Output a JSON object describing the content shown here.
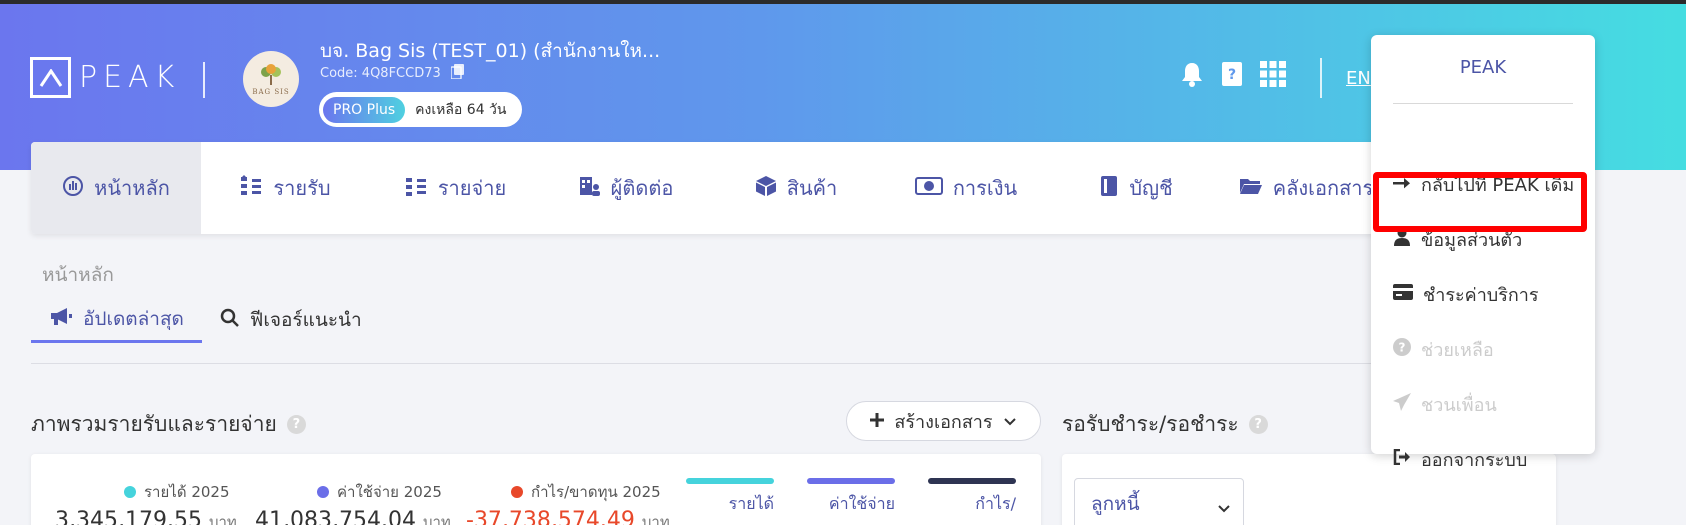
{
  "header": {
    "logo": "PEAK",
    "company_name": "บจ. Bag Sis (TEST_01) (สำนักงานให...",
    "company_code": "Code: 4Q8FCCD73",
    "avatar_text": "BAG SIS",
    "plan": "PRO Plus",
    "days_left": "คงเหลือ 64 วัน",
    "lang": "EN",
    "icons": [
      "bell-icon",
      "book-icon",
      "apps-grid-icon"
    ]
  },
  "nav": {
    "items": [
      {
        "label": "หน้าหลัก",
        "icon": "dashboard-icon"
      },
      {
        "label": "รายรับ",
        "icon": "income-icon"
      },
      {
        "label": "รายจ่าย",
        "icon": "expense-icon"
      },
      {
        "label": "ผู้ติดต่อ",
        "icon": "contacts-icon"
      },
      {
        "label": "สินค้า",
        "icon": "product-box-icon"
      },
      {
        "label": "การเงิน",
        "icon": "money-icon"
      },
      {
        "label": "บัญชี",
        "icon": "accounting-book-icon"
      },
      {
        "label": "คลังเอกสาร",
        "icon": "folder-icon"
      }
    ]
  },
  "breadcrumb": "หน้าหลัก",
  "tabs": [
    {
      "label": "อัปเดตล่าสุด",
      "icon": "megaphone-icon"
    },
    {
      "label": "ฟีเจอร์แนะนำ",
      "icon": "search-icon"
    }
  ],
  "overview": {
    "title": "ภาพรวมรายรับและรายจ่าย",
    "create_button": "สร้างเอกสาร",
    "stats": [
      {
        "label": "รายได้ 2025",
        "value": "3,345,179.55",
        "unit": "บาท",
        "color": "#45d3dc"
      },
      {
        "label": "ค่าใช้จ่าย 2025",
        "value": "41,083,754.04",
        "unit": "บาท",
        "color": "#6b6ee8"
      },
      {
        "label": "กำไร/ขาดทุน 2025",
        "value": "-37,738,574.49",
        "unit": "บาท",
        "color": "#e8482a"
      }
    ],
    "legend": [
      {
        "label": "รายได้",
        "color": "#45d3dc"
      },
      {
        "label": "ค่าใช้จ่าย",
        "color": "#6b6ee8"
      },
      {
        "label": "กำไร/ขาดทุน",
        "color": "#2e3452"
      }
    ]
  },
  "receivables": {
    "title": "รอรับชำระ/รอชำระ",
    "select_value": "ลูกหนี้"
  },
  "menu": {
    "title": "PEAK",
    "items": [
      {
        "label": "กลับไปที่ PEAK เดิม",
        "icon": "arrow-right-icon"
      },
      {
        "label": "ข้อมูลส่วนตัว",
        "icon": "user-icon"
      },
      {
        "label": "ชำระค่าบริการ",
        "icon": "credit-card-icon"
      },
      {
        "label": "ช่วยเหลือ",
        "icon": "help-circle-icon"
      },
      {
        "label": "ชวนเพื่อน",
        "icon": "paper-plane-icon"
      },
      {
        "label": "ออกจากระบบ",
        "icon": "logout-icon"
      }
    ]
  }
}
